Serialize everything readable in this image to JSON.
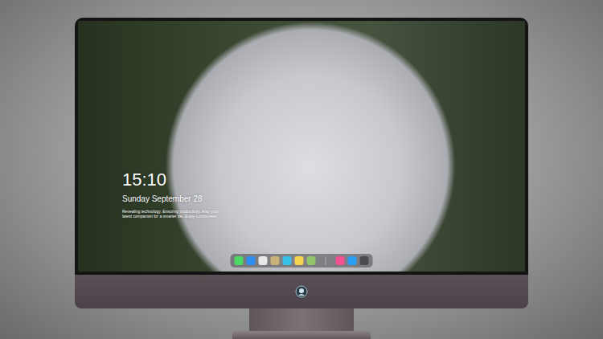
{
  "lock_screen": {
    "time": "15:10",
    "date": "Sunday September 28",
    "tagline": "Revealing technology. Ensuring productivity. Also your latest companion for a smarter life. Enjoy Lockscreen"
  },
  "dock": {
    "apps": [
      {
        "color": "#4cd964"
      },
      {
        "color": "#2f8ff0"
      },
      {
        "color": "#e8e8e8"
      },
      {
        "color": "#c9b27a"
      },
      {
        "color": "#39c0e6"
      },
      {
        "color": "#f5d451"
      },
      {
        "color": "#8fc46a"
      }
    ],
    "recent": [
      {
        "color": "#f2508f"
      },
      {
        "color": "#2a9df4"
      },
      {
        "color": "#4a4a4f"
      }
    ]
  }
}
